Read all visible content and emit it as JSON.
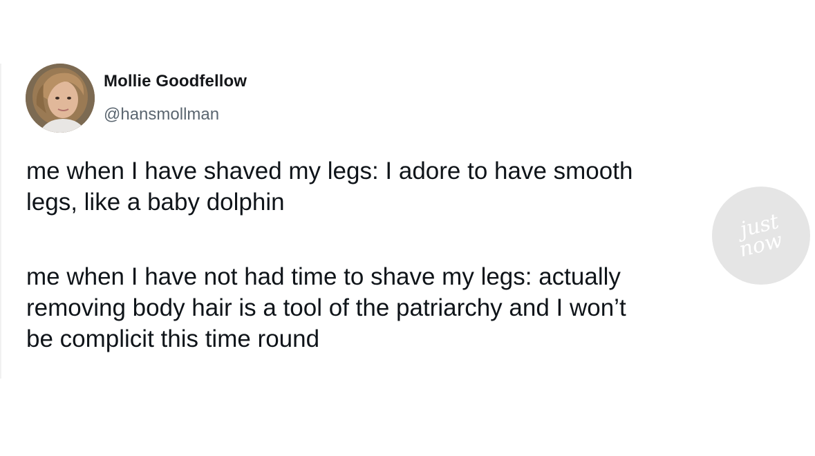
{
  "tweet": {
    "author": {
      "name": "Mollie Goodfellow",
      "handle": "@hansmollman"
    },
    "paragraphs": [
      {
        "lines": [
          "me when I have shaved my legs: I adore to have smooth",
          "legs, like a baby dolphin"
        ]
      },
      {
        "lines": [
          "me when I have not had time to shave my legs: actually",
          "removing body hair is a tool of the patriarchy and I won’t",
          "be complicit this time round"
        ]
      }
    ]
  },
  "watermark": {
    "text_line1": "just",
    "text_line2": "now"
  }
}
